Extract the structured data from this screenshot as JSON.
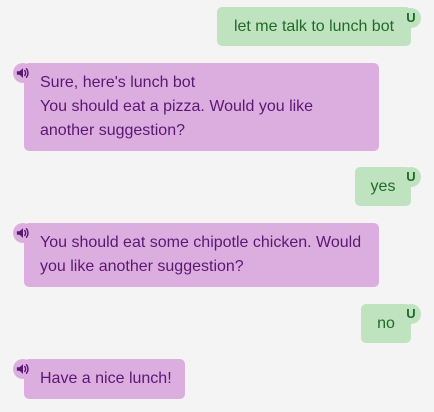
{
  "user_avatar_label": "U",
  "speaker_icon": "speaker-volume-icon",
  "colors": {
    "background": "#f4f4f4",
    "user_bubble": "#bfe3bf",
    "user_text": "#1f6b2a",
    "bot_bubble": "#dcaedf",
    "bot_text": "#5b1773"
  },
  "messages": [
    {
      "from": "user",
      "text": "let me talk to lunch bot"
    },
    {
      "from": "bot",
      "lines": [
        "Sure, here's lunch bot",
        "You should eat a pizza. Would you like",
        "another suggestion?"
      ]
    },
    {
      "from": "user",
      "text": "yes"
    },
    {
      "from": "bot",
      "lines": [
        "You should eat some chipotle chicken. Would",
        "you like another suggestion?"
      ]
    },
    {
      "from": "user",
      "text": "no"
    },
    {
      "from": "bot",
      "lines": [
        "Have a nice lunch!"
      ]
    }
  ]
}
